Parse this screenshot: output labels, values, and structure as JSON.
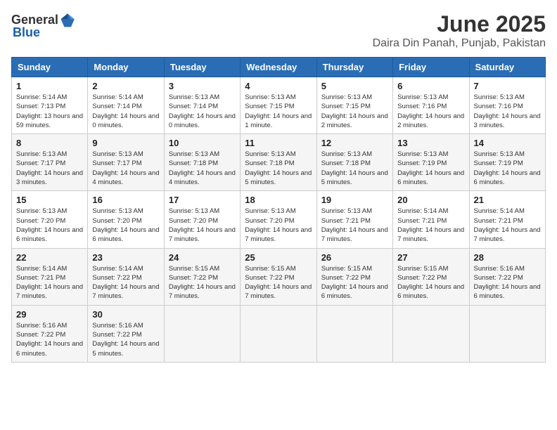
{
  "header": {
    "logo_general": "General",
    "logo_blue": "Blue",
    "month": "June 2025",
    "location": "Daira Din Panah, Punjab, Pakistan"
  },
  "weekdays": [
    "Sunday",
    "Monday",
    "Tuesday",
    "Wednesday",
    "Thursday",
    "Friday",
    "Saturday"
  ],
  "weeks": [
    [
      {
        "day": "1",
        "sunrise": "5:14 AM",
        "sunset": "7:13 PM",
        "daylight": "13 hours and 59 minutes."
      },
      {
        "day": "2",
        "sunrise": "5:14 AM",
        "sunset": "7:14 PM",
        "daylight": "14 hours and 0 minutes."
      },
      {
        "day": "3",
        "sunrise": "5:13 AM",
        "sunset": "7:14 PM",
        "daylight": "14 hours and 0 minutes."
      },
      {
        "day": "4",
        "sunrise": "5:13 AM",
        "sunset": "7:15 PM",
        "daylight": "14 hours and 1 minute."
      },
      {
        "day": "5",
        "sunrise": "5:13 AM",
        "sunset": "7:15 PM",
        "daylight": "14 hours and 2 minutes."
      },
      {
        "day": "6",
        "sunrise": "5:13 AM",
        "sunset": "7:16 PM",
        "daylight": "14 hours and 2 minutes."
      },
      {
        "day": "7",
        "sunrise": "5:13 AM",
        "sunset": "7:16 PM",
        "daylight": "14 hours and 3 minutes."
      }
    ],
    [
      {
        "day": "8",
        "sunrise": "5:13 AM",
        "sunset": "7:17 PM",
        "daylight": "14 hours and 3 minutes."
      },
      {
        "day": "9",
        "sunrise": "5:13 AM",
        "sunset": "7:17 PM",
        "daylight": "14 hours and 4 minutes."
      },
      {
        "day": "10",
        "sunrise": "5:13 AM",
        "sunset": "7:18 PM",
        "daylight": "14 hours and 4 minutes."
      },
      {
        "day": "11",
        "sunrise": "5:13 AM",
        "sunset": "7:18 PM",
        "daylight": "14 hours and 5 minutes."
      },
      {
        "day": "12",
        "sunrise": "5:13 AM",
        "sunset": "7:18 PM",
        "daylight": "14 hours and 5 minutes."
      },
      {
        "day": "13",
        "sunrise": "5:13 AM",
        "sunset": "7:19 PM",
        "daylight": "14 hours and 6 minutes."
      },
      {
        "day": "14",
        "sunrise": "5:13 AM",
        "sunset": "7:19 PM",
        "daylight": "14 hours and 6 minutes."
      }
    ],
    [
      {
        "day": "15",
        "sunrise": "5:13 AM",
        "sunset": "7:20 PM",
        "daylight": "14 hours and 6 minutes."
      },
      {
        "day": "16",
        "sunrise": "5:13 AM",
        "sunset": "7:20 PM",
        "daylight": "14 hours and 6 minutes."
      },
      {
        "day": "17",
        "sunrise": "5:13 AM",
        "sunset": "7:20 PM",
        "daylight": "14 hours and 7 minutes."
      },
      {
        "day": "18",
        "sunrise": "5:13 AM",
        "sunset": "7:20 PM",
        "daylight": "14 hours and 7 minutes."
      },
      {
        "day": "19",
        "sunrise": "5:13 AM",
        "sunset": "7:21 PM",
        "daylight": "14 hours and 7 minutes."
      },
      {
        "day": "20",
        "sunrise": "5:14 AM",
        "sunset": "7:21 PM",
        "daylight": "14 hours and 7 minutes."
      },
      {
        "day": "21",
        "sunrise": "5:14 AM",
        "sunset": "7:21 PM",
        "daylight": "14 hours and 7 minutes."
      }
    ],
    [
      {
        "day": "22",
        "sunrise": "5:14 AM",
        "sunset": "7:21 PM",
        "daylight": "14 hours and 7 minutes."
      },
      {
        "day": "23",
        "sunrise": "5:14 AM",
        "sunset": "7:22 PM",
        "daylight": "14 hours and 7 minutes."
      },
      {
        "day": "24",
        "sunrise": "5:15 AM",
        "sunset": "7:22 PM",
        "daylight": "14 hours and 7 minutes."
      },
      {
        "day": "25",
        "sunrise": "5:15 AM",
        "sunset": "7:22 PM",
        "daylight": "14 hours and 7 minutes."
      },
      {
        "day": "26",
        "sunrise": "5:15 AM",
        "sunset": "7:22 PM",
        "daylight": "14 hours and 6 minutes."
      },
      {
        "day": "27",
        "sunrise": "5:15 AM",
        "sunset": "7:22 PM",
        "daylight": "14 hours and 6 minutes."
      },
      {
        "day": "28",
        "sunrise": "5:16 AM",
        "sunset": "7:22 PM",
        "daylight": "14 hours and 6 minutes."
      }
    ],
    [
      {
        "day": "29",
        "sunrise": "5:16 AM",
        "sunset": "7:22 PM",
        "daylight": "14 hours and 6 minutes."
      },
      {
        "day": "30",
        "sunrise": "5:16 AM",
        "sunset": "7:22 PM",
        "daylight": "14 hours and 5 minutes."
      },
      {
        "day": "",
        "sunrise": "",
        "sunset": "",
        "daylight": ""
      },
      {
        "day": "",
        "sunrise": "",
        "sunset": "",
        "daylight": ""
      },
      {
        "day": "",
        "sunrise": "",
        "sunset": "",
        "daylight": ""
      },
      {
        "day": "",
        "sunrise": "",
        "sunset": "",
        "daylight": ""
      },
      {
        "day": "",
        "sunrise": "",
        "sunset": "",
        "daylight": ""
      }
    ]
  ],
  "labels": {
    "sunrise": "Sunrise:",
    "sunset": "Sunset:",
    "daylight": "Daylight hours"
  }
}
